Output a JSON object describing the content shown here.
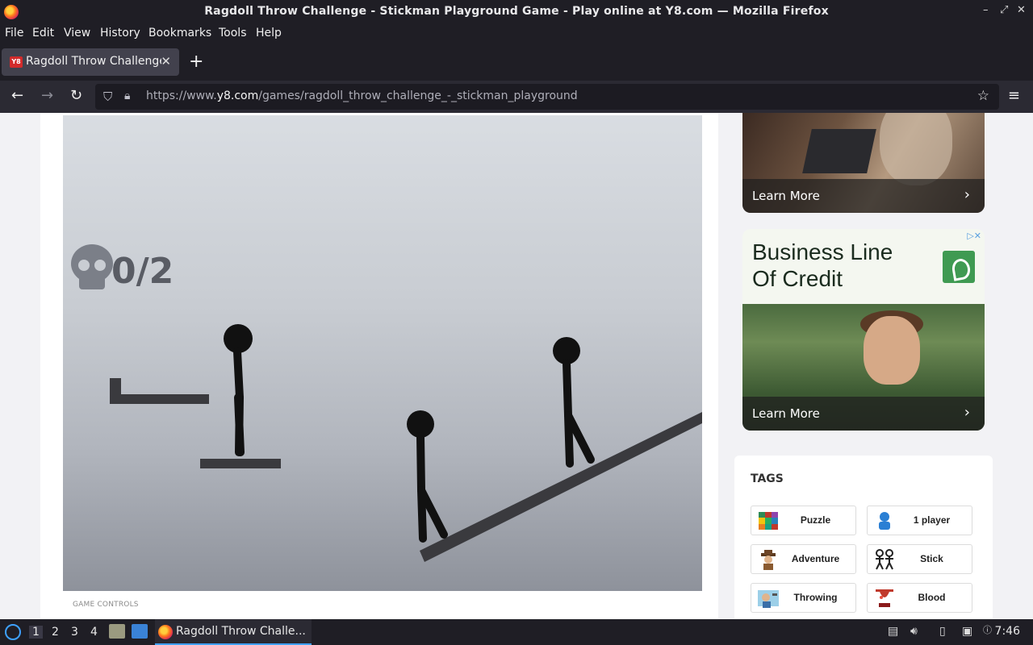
{
  "window": {
    "title": "Ragdoll Throw Challenge - Stickman Playground Game - Play online at Y8.com — Mozilla Firefox",
    "controls": [
      "–",
      "⤢",
      "✕"
    ]
  },
  "menu": [
    "File",
    "Edit",
    "View",
    "History",
    "Bookmarks",
    "Tools",
    "Help"
  ],
  "tab": {
    "favicon": "Y8",
    "title": "Ragdoll Throw Challenge - Stickman Playground Game",
    "close": "✕",
    "new_tab": "+"
  },
  "nav": {
    "back": "←",
    "forward": "→",
    "reload": "↻",
    "url_prefix": "https://www.",
    "url_domain": "y8.com",
    "url_path": "/games/ragdoll_throw_challenge_-_stickman_playground",
    "bookmark": "☆",
    "menu": "≡"
  },
  "game": {
    "kill_count": "0/2",
    "controls_label": "GAME CONTROLS"
  },
  "ads": {
    "ad1_cta": "Learn More",
    "ad2_headline_line1": "Business Line",
    "ad2_headline_line2": "Of Credit",
    "ad2_cta": "Learn More",
    "chevron": "›",
    "adchoices": "▷✕"
  },
  "tags": {
    "title": "TAGS",
    "items": [
      {
        "label": "Puzzle",
        "icon": "puzzle-icon"
      },
      {
        "label": "1 player",
        "icon": "one-player-icon"
      },
      {
        "label": "Adventure",
        "icon": "adventure-icon"
      },
      {
        "label": "Stick",
        "icon": "stick-icon"
      },
      {
        "label": "Throwing",
        "icon": "throwing-icon"
      },
      {
        "label": "Blood",
        "icon": "blood-icon"
      }
    ]
  },
  "taskbar": {
    "workspaces": [
      "1",
      "2",
      "3",
      "4"
    ],
    "task_title": "Ragdoll Throw Challe...",
    "clock": "7:46"
  }
}
